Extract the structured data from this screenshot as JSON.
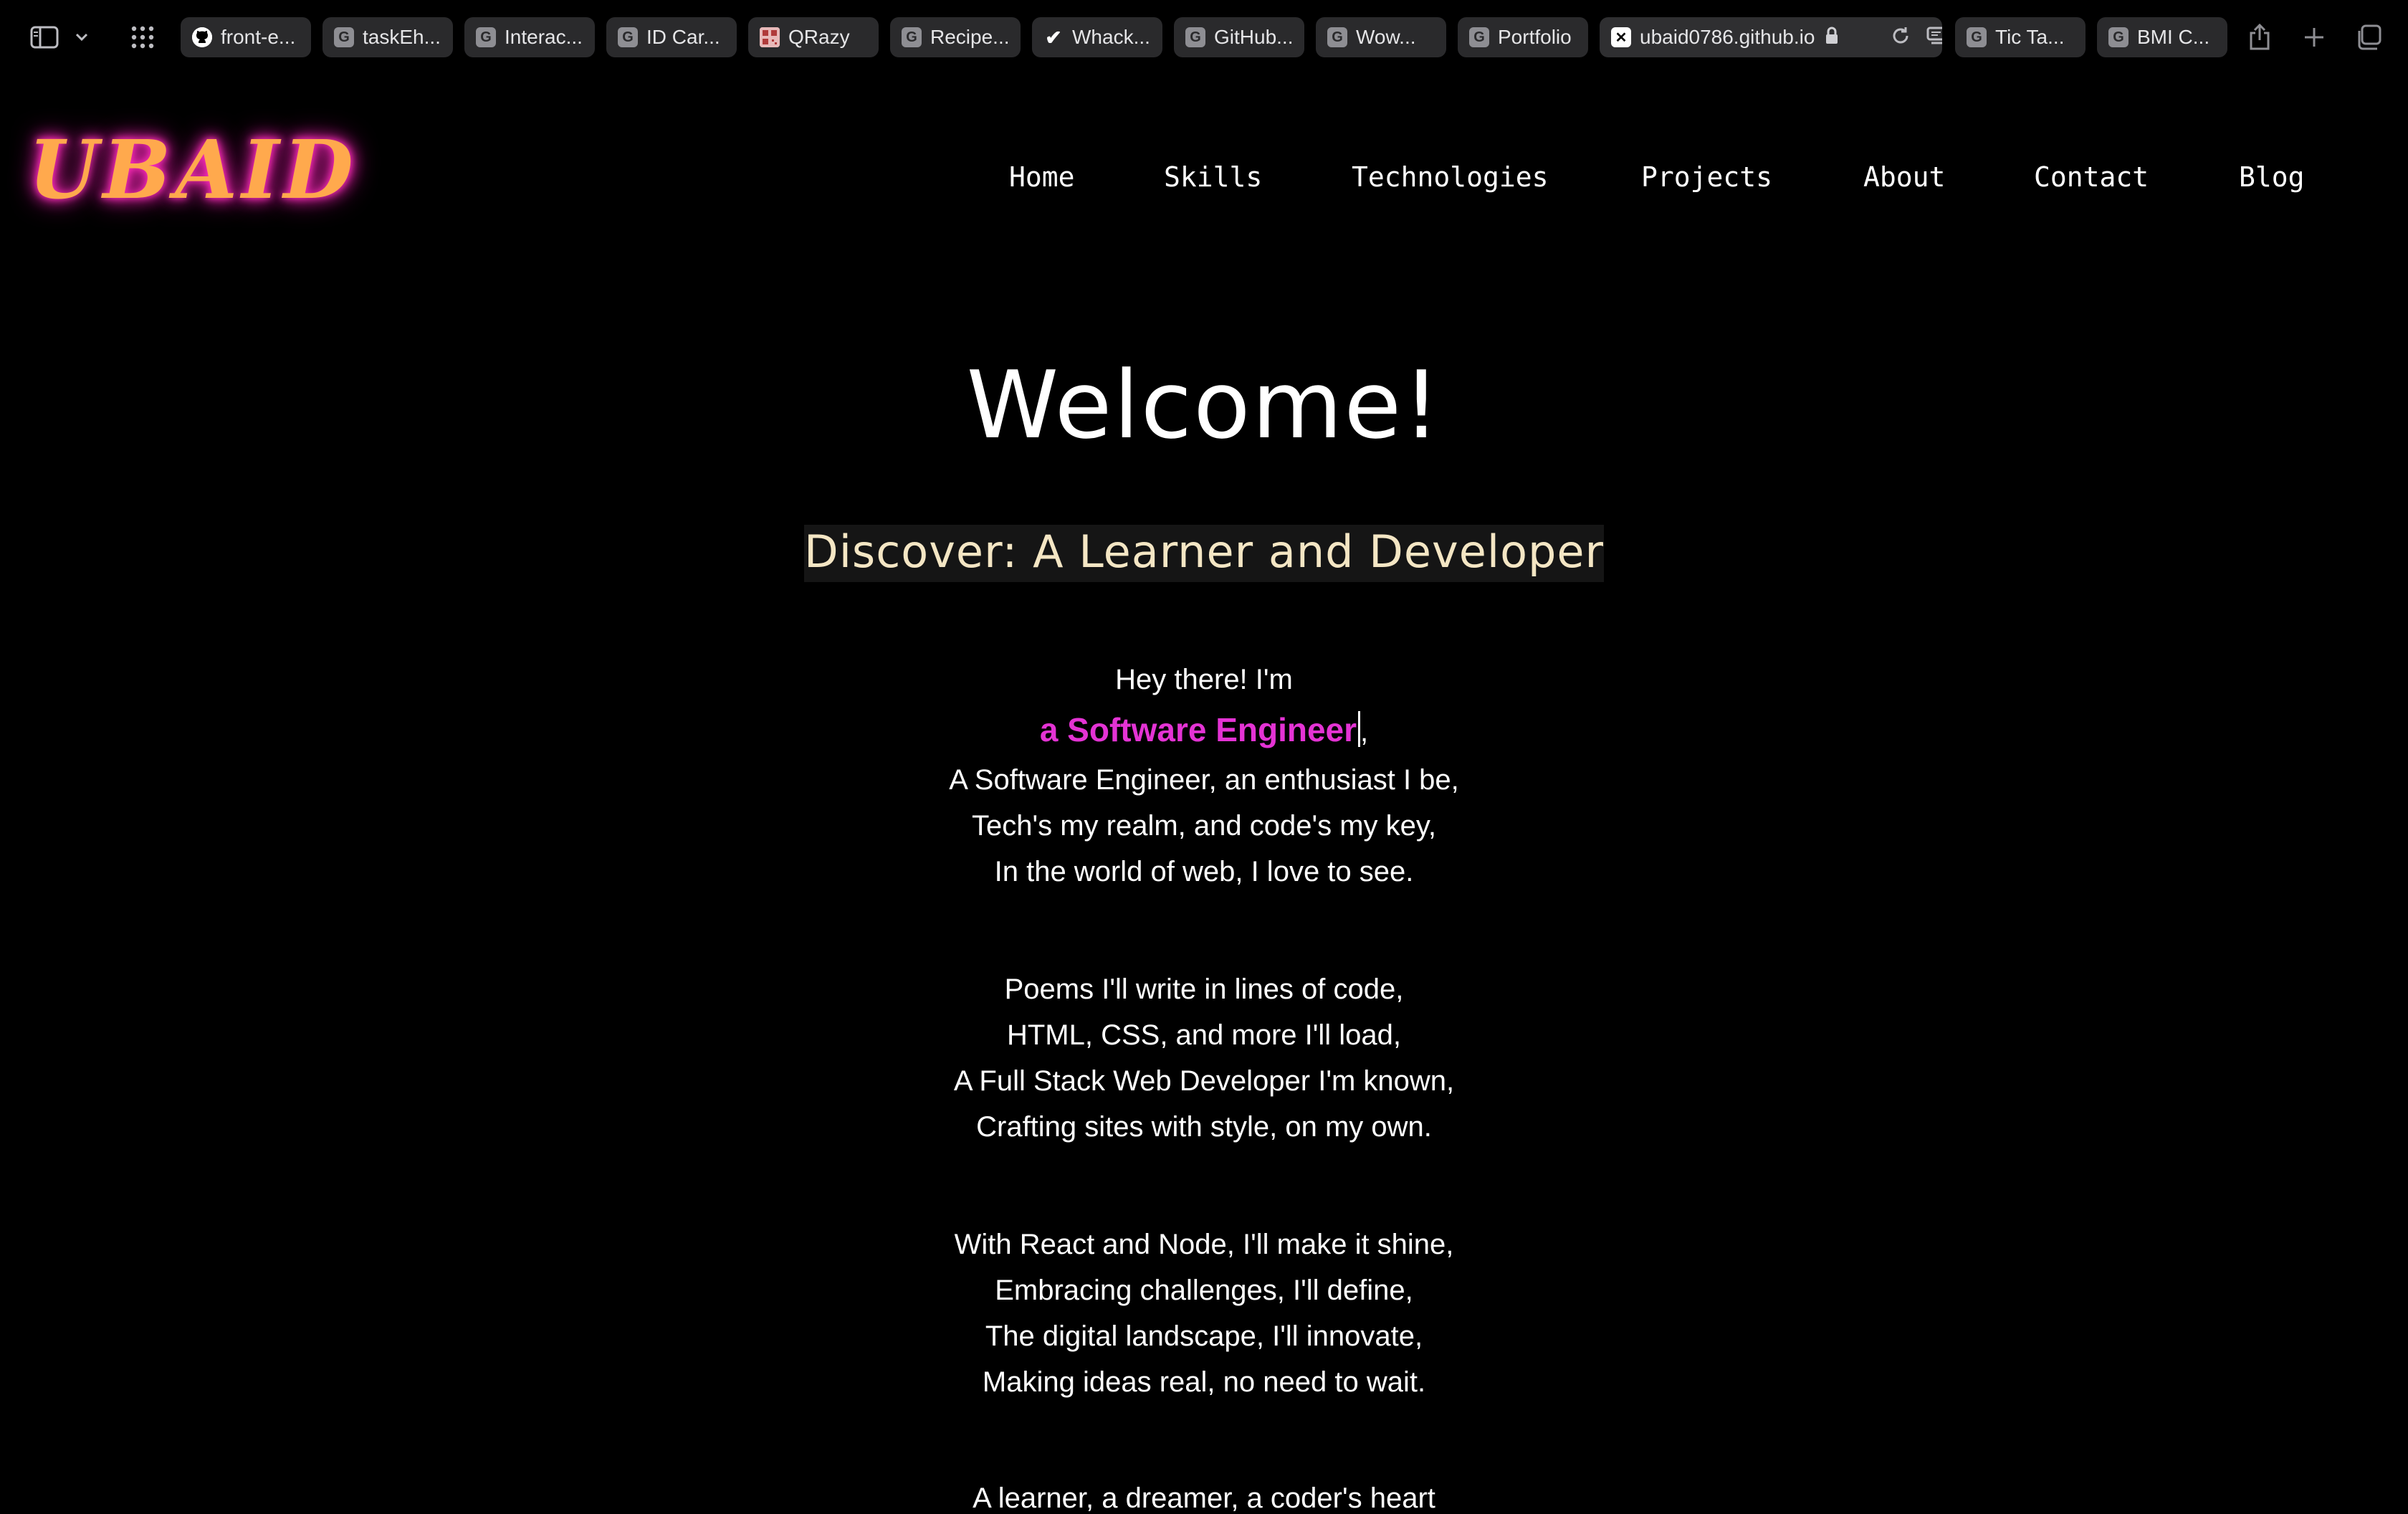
{
  "browser": {
    "tabs": [
      {
        "title": "front-e...",
        "icon": "github-icon"
      },
      {
        "title": "taskEh...",
        "icon": "g-favicon-icon"
      },
      {
        "title": "Interac...",
        "icon": "g-favicon-icon"
      },
      {
        "title": "ID Car...",
        "icon": "g-favicon-icon"
      },
      {
        "title": "QRazy",
        "icon": "qr-favicon-icon"
      },
      {
        "title": "Recipe...",
        "icon": "g-favicon-icon"
      },
      {
        "title": "Whack...",
        "icon": "check-favicon-icon"
      },
      {
        "title": "GitHub...",
        "icon": "g-favicon-icon"
      },
      {
        "title": "Wow...",
        "icon": "g-favicon-icon"
      },
      {
        "title": "Portfolio",
        "icon": "g-favicon-icon"
      },
      {
        "title": "ubaid0786.github.io",
        "icon": "x-favicon-icon",
        "active": true
      },
      {
        "title": "Tic Ta...",
        "icon": "g-favicon-icon"
      },
      {
        "title": "BMI C...",
        "icon": "g-favicon-icon"
      }
    ],
    "favicon_letter": "G"
  },
  "site": {
    "logo": "UBAID",
    "nav": [
      "Home",
      "Skills",
      "Technologies",
      "Projects",
      "About",
      "Contact",
      "Blog"
    ]
  },
  "hero": {
    "title": "Welcome!",
    "subtitle": "Discover: A Learner and Developer",
    "greeting": "Hey there! I'm",
    "role": "a Software Engineer",
    "role_suffix": ",",
    "stanza1": [
      "A Software Engineer, an enthusiast I be,",
      "Tech's my realm, and code's my key,",
      "In the world of web, I love to see."
    ],
    "stanza2": [
      "Poems I'll write in lines of code,",
      "HTML, CSS, and more I'll load,",
      "A Full Stack Web Developer I'm known,",
      "Crafting sites with style, on my own."
    ],
    "stanza3": [
      "With React and Node, I'll make it shine,",
      "Embracing challenges, I'll define,",
      "The digital landscape, I'll innovate,",
      "Making ideas real, no need to wait."
    ],
    "stanza4": [
      "A learner, a dreamer, a coder's heart"
    ]
  },
  "colors": {
    "background": "#000000",
    "logo_fill": "#ffa94d",
    "logo_glow": "#ff2dbd",
    "role_accent": "#e433d4",
    "subtitle_text": "#f4e6c4"
  }
}
